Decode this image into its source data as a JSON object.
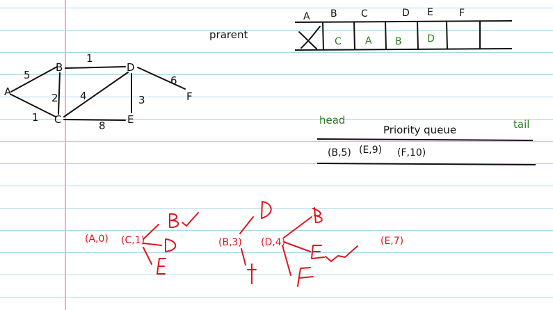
{
  "graph": {
    "nodes": [
      "A",
      "B",
      "C",
      "D",
      "E",
      "F"
    ],
    "edge_weights": {
      "A_B": "5",
      "A_C": "1",
      "B_C": "2",
      "B_D": "1",
      "C_D": "4",
      "C_E": "8",
      "D_E": "3",
      "D_F": "6"
    }
  },
  "parent_table": {
    "title": "prarent",
    "headers": [
      "A",
      "B",
      "C",
      "D",
      "E",
      "F"
    ],
    "cells": [
      "",
      "C",
      "A",
      "B",
      "D",
      ""
    ]
  },
  "priority_queue": {
    "head_label": "head",
    "title": "Priority queue",
    "tail_label": "tail",
    "items": [
      "(B,5)",
      "(E,9)",
      "(F,10)"
    ]
  },
  "scratch": {
    "steps": [
      "(A,0)",
      "(C,1)",
      "(B,3)",
      "(D,4)",
      "(E,7)"
    ]
  },
  "colors": {
    "ink": "#111111",
    "green": "#2e7d1f",
    "red": "#e0141e",
    "ruled_line": "#a9d6e5",
    "margin_line": "#f7a8c9"
  }
}
